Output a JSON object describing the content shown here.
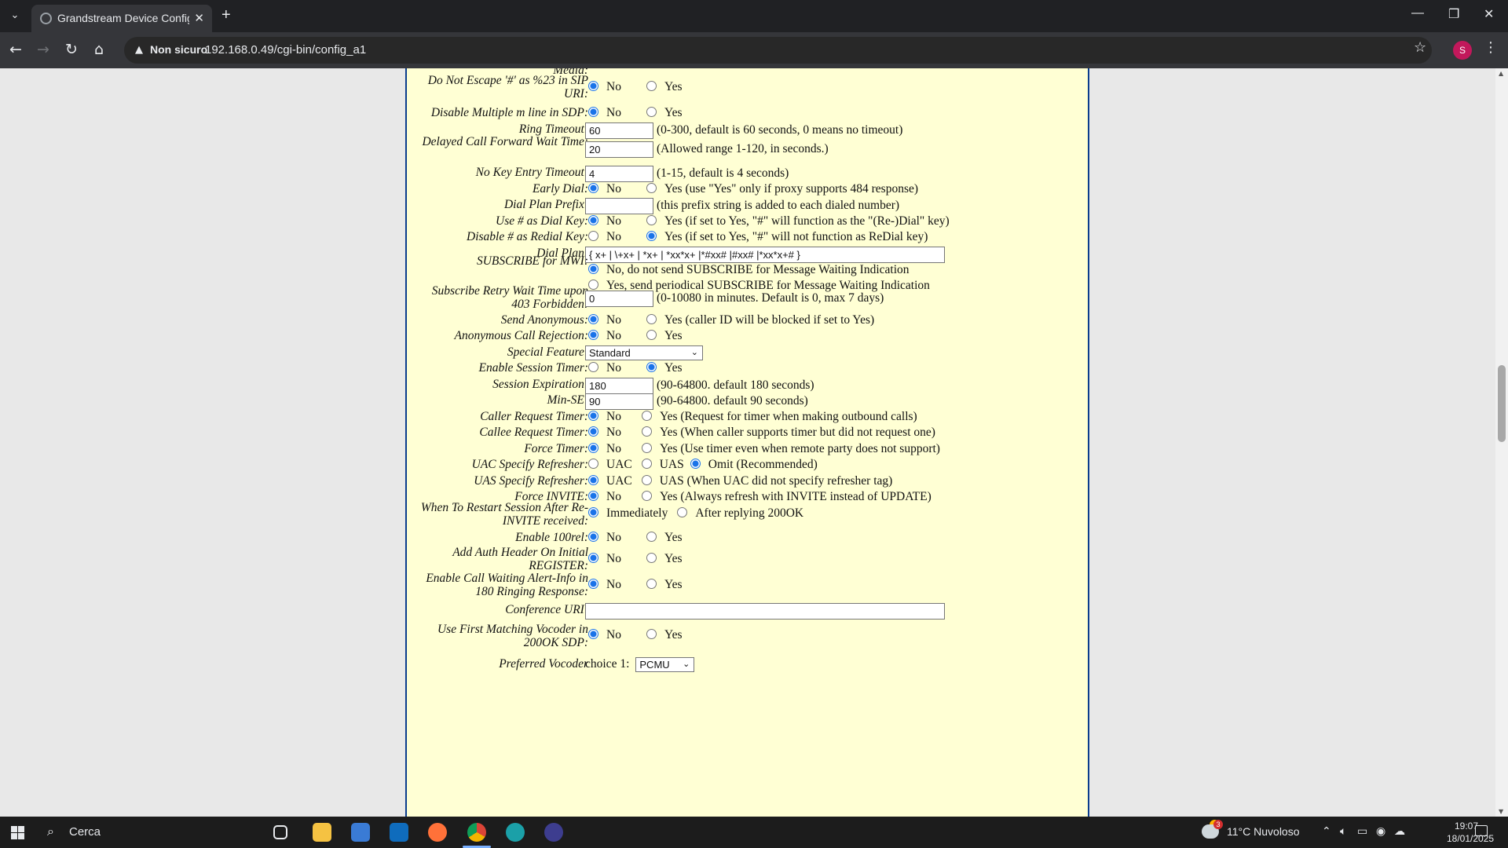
{
  "browser": {
    "tab_title": "Grandstream Device Configurati",
    "security_label": "Non sicuro",
    "url": "192.168.0.49/cgi-bin/config_a1",
    "profile_initial": "S"
  },
  "settings": [
    {
      "label": "Media:",
      "type": "radio",
      "options": [
        {
          "label": "No",
          "checked": true
        },
        {
          "label": "Yes",
          "checked": false
        }
      ]
    },
    {
      "label": "Do Not Escape '#' as %23 in SIP URI:",
      "type": "radio",
      "options": [
        {
          "label": "No",
          "checked": true
        },
        {
          "label": "Yes",
          "checked": false
        }
      ]
    },
    {
      "label": "Disable Multiple m line in SDP:",
      "type": "radio",
      "options": [
        {
          "label": "No",
          "checked": true
        },
        {
          "label": "Yes",
          "checked": false
        }
      ]
    },
    {
      "label": "Ring Timeout:",
      "type": "text",
      "value": "60",
      "note": "(0-300, default is 60 seconds, 0 means no timeout)"
    },
    {
      "label": "Delayed Call Forward Wait Time:",
      "type": "text",
      "value": "20",
      "note": "(Allowed range 1-120, in seconds.)"
    },
    {
      "label": "No Key Entry Timeout:",
      "type": "text",
      "value": "4",
      "note": "(1-15, default is 4 seconds)"
    },
    {
      "label": "Early Dial:",
      "type": "radio",
      "options": [
        {
          "label": "No",
          "checked": true
        },
        {
          "label": "Yes",
          "checked": false
        }
      ],
      "note": "(use \"Yes\" only if proxy supports 484 response)"
    },
    {
      "label": "Dial Plan Prefix:",
      "type": "text",
      "value": "",
      "note": "(this prefix string is added to each dialed number)"
    },
    {
      "label": "Use # as Dial Key:",
      "type": "radio",
      "options": [
        {
          "label": "No",
          "checked": true
        },
        {
          "label": "Yes",
          "checked": false
        }
      ],
      "note": "(if set to Yes, \"#\" will function as the \"(Re-)Dial\" key)"
    },
    {
      "label": "Disable # as Redial Key:",
      "type": "radio",
      "options": [
        {
          "label": "No",
          "checked": false
        },
        {
          "label": "Yes",
          "checked": true
        }
      ],
      "note": "(if set to Yes, \"#\" will not function as ReDial key)"
    },
    {
      "label": "Dial Plan:",
      "type": "text",
      "value": "{ x+ | \\+x+ | *x+ | *xx*x+ |*#xx# |#xx# |*xx*x+# }"
    },
    {
      "label": "SUBSCRIBE for MWI:",
      "type": "radio_stack",
      "options": [
        {
          "label": "No, do not send SUBSCRIBE for Message Waiting Indication",
          "checked": true
        },
        {
          "label": "Yes, send periodical SUBSCRIBE for Message Waiting Indication",
          "checked": false
        }
      ]
    },
    {
      "label": "Subscribe Retry Wait Time upon 403 Forbidden:",
      "type": "text",
      "value": "0",
      "note": "(0-10080 in minutes. Default is 0, max 7 days)"
    },
    {
      "label": "Send Anonymous:",
      "type": "radio",
      "options": [
        {
          "label": "No",
          "checked": true
        },
        {
          "label": "Yes",
          "checked": false
        }
      ],
      "note": "(caller ID will be blocked if set to Yes)"
    },
    {
      "label": "Anonymous Call Rejection:",
      "type": "radio",
      "options": [
        {
          "label": "No",
          "checked": true
        },
        {
          "label": "Yes",
          "checked": false
        }
      ]
    },
    {
      "label": "Special Feature:",
      "type": "select",
      "value": "Standard"
    },
    {
      "label": "Enable Session Timer:",
      "type": "radio",
      "options": [
        {
          "label": "No",
          "checked": false
        },
        {
          "label": "Yes",
          "checked": true
        }
      ]
    },
    {
      "label": "Session Expiration:",
      "type": "text",
      "value": "180",
      "note": "(90-64800. default 180 seconds)"
    },
    {
      "label": "Min-SE:",
      "type": "text",
      "value": "90",
      "note": "(90-64800. default 90 seconds)"
    },
    {
      "label": "Caller Request Timer:",
      "type": "radio",
      "options": [
        {
          "label": "No",
          "checked": true
        },
        {
          "label": "Yes (Request for timer when making outbound calls)",
          "checked": false
        }
      ]
    },
    {
      "label": "Callee Request Timer:",
      "type": "radio",
      "options": [
        {
          "label": "No",
          "checked": true
        },
        {
          "label": "Yes (When caller supports timer but did not request one)",
          "checked": false
        }
      ]
    },
    {
      "label": "Force Timer:",
      "type": "radio",
      "options": [
        {
          "label": "No",
          "checked": true
        },
        {
          "label": "Yes (Use timer even when remote party does not support)",
          "checked": false
        }
      ]
    },
    {
      "label": "UAC Specify Refresher:",
      "type": "radio",
      "options": [
        {
          "label": "UAC",
          "checked": false
        },
        {
          "label": "UAS",
          "checked": false
        },
        {
          "label": "Omit (Recommended)",
          "checked": true
        }
      ]
    },
    {
      "label": "UAS Specify Refresher:",
      "type": "radio",
      "options": [
        {
          "label": "UAC",
          "checked": true
        },
        {
          "label": "UAS (When UAC did not specify refresher tag)",
          "checked": false
        }
      ]
    },
    {
      "label": "Force INVITE:",
      "type": "radio",
      "options": [
        {
          "label": "No",
          "checked": true
        },
        {
          "label": "Yes (Always refresh with INVITE instead of UPDATE)",
          "checked": false
        }
      ]
    },
    {
      "label": "When To Restart Session After Re-INVITE received:",
      "type": "radio",
      "options": [
        {
          "label": "Immediately",
          "checked": true
        },
        {
          "label": "After replying 200OK",
          "checked": false
        }
      ]
    },
    {
      "label": "Enable 100rel:",
      "type": "radio",
      "options": [
        {
          "label": "No",
          "checked": true
        },
        {
          "label": "Yes",
          "checked": false
        }
      ]
    },
    {
      "label": "Add Auth Header On Initial REGISTER:",
      "type": "radio",
      "options": [
        {
          "label": "No",
          "checked": true
        },
        {
          "label": "Yes",
          "checked": false
        }
      ]
    },
    {
      "label": "Enable Call Waiting Alert-Info in 180 Ringing Response:",
      "type": "radio",
      "options": [
        {
          "label": "No",
          "checked": true
        },
        {
          "label": "Yes",
          "checked": false
        }
      ]
    },
    {
      "label": "Conference URI:",
      "type": "text",
      "value": ""
    },
    {
      "label": "Use First Matching Vocoder in 200OK SDP:",
      "type": "radio",
      "options": [
        {
          "label": "No",
          "checked": true
        },
        {
          "label": "Yes",
          "checked": false
        }
      ]
    },
    {
      "label": "Preferred Vocoder",
      "type": "vocoder",
      "choice_label": "choice 1:",
      "value": "PCMU"
    }
  ],
  "taskbar": {
    "search_placeholder": "Cerca",
    "weather_badge": "3",
    "weather": "11°C  Nuvoloso",
    "time": "19:07",
    "date": "18/01/2025"
  }
}
